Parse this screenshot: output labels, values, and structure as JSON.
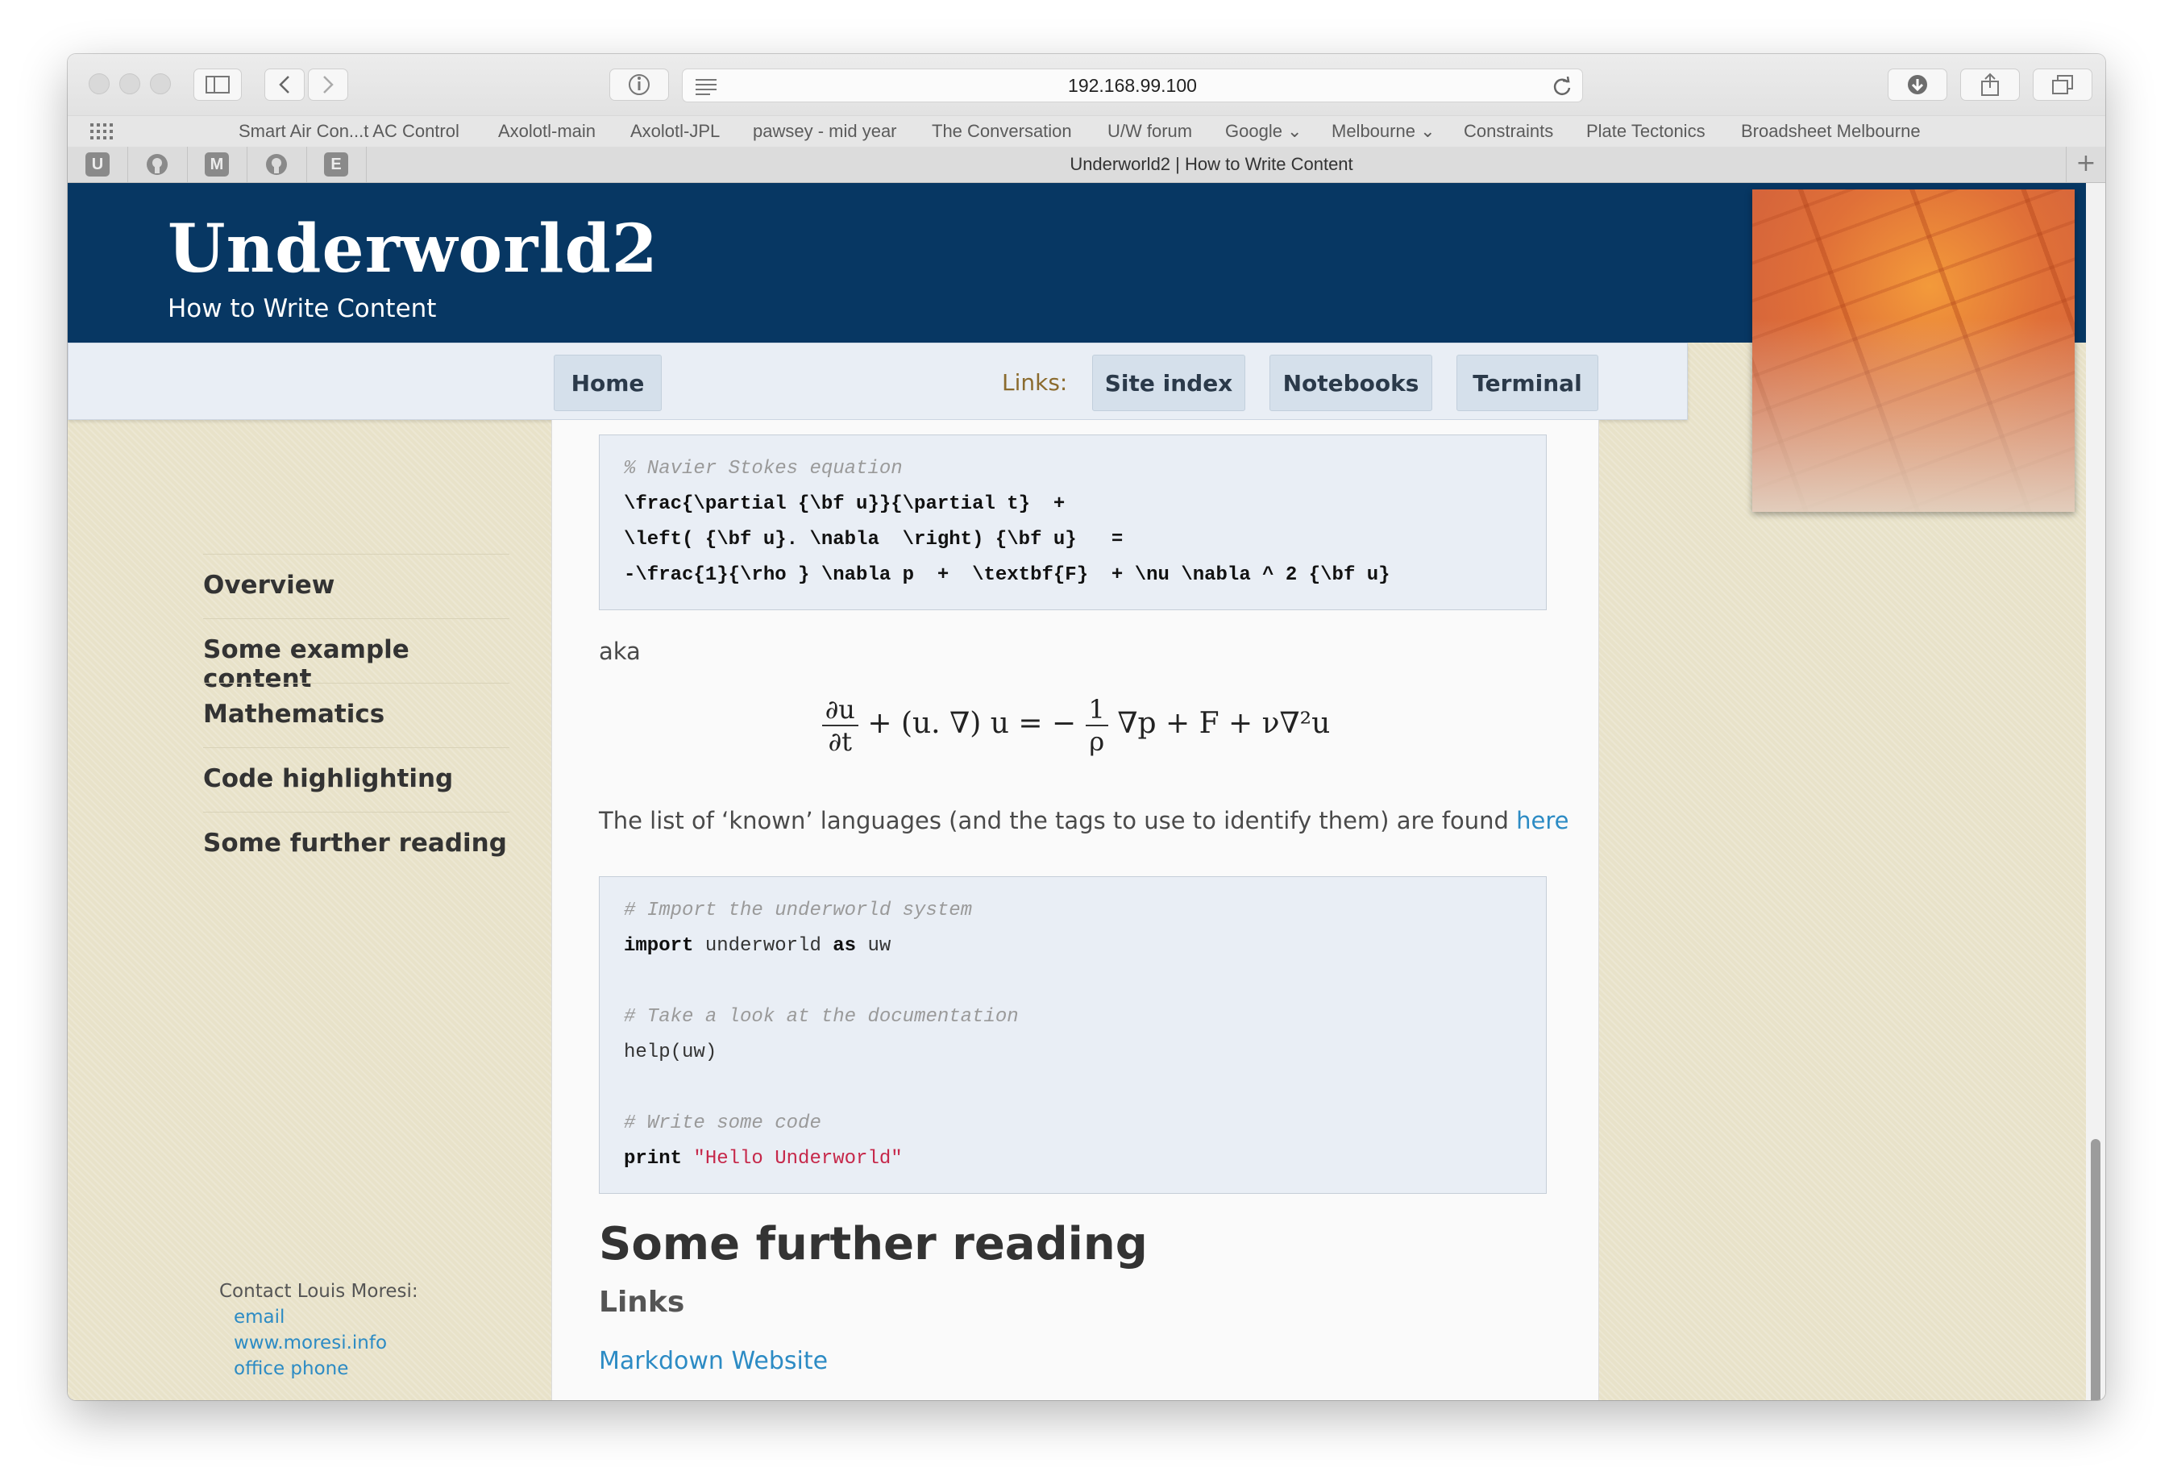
{
  "browser": {
    "url": "192.168.99.100",
    "tab_title": "Underworld2 | How to Write Content",
    "bookmarks": [
      "Smart Air Con...t AC Control",
      "Axolotl-main",
      "Axolotl-JPL",
      "pawsey - mid year",
      "The Conversation",
      "U/W forum",
      "Google ⌄",
      "Melbourne ⌄",
      "Constraints",
      "Plate Tectonics",
      "Broadsheet Melbourne"
    ],
    "pinned_tabs": [
      "U",
      "github",
      "M",
      "github",
      "E"
    ]
  },
  "site": {
    "title": "Underworld2",
    "subtitle": "How to Write Content"
  },
  "nav": {
    "home": "Home",
    "links_label": "Links:",
    "site_index": "Site index",
    "notebooks": "Notebooks",
    "terminal": "Terminal"
  },
  "sidebar": {
    "items": [
      "Overview",
      "Some example content",
      "Mathematics",
      "Code highlighting",
      "Some further reading"
    ],
    "contact_label": "Contact Louis Moresi:",
    "contact_links": [
      "email",
      "www.moresi.info",
      "office phone"
    ]
  },
  "content": {
    "latex_lines": [
      "% Navier Stokes equation",
      "\\frac{\\partial {\\bf u}}{\\partial t}  +",
      "\\left( {\\bf u}. \\nabla  \\right) {\\bf u}   =",
      "-\\frac{1}{\\rho } \\nabla p  +  \\textbf{F}  + \\nu \\nabla ^ 2 {\\bf u}"
    ],
    "aka": "aka",
    "equation": {
      "lhs_num": "∂u",
      "lhs_den": "∂t",
      "middle": "+ (u. ∇) u = −",
      "rho_num": "1",
      "rho_den": "ρ",
      "rhs": "∇p + F + ν∇²u"
    },
    "languages_text": "The list of ‘known’ languages (and the tags to use to identify them) are found ",
    "languages_link": "here",
    "code": {
      "comment1": "# Import the underworld system",
      "import_kw": "import",
      "import_mod": " underworld ",
      "as_kw": "as",
      "alias": " uw",
      "comment2": "# Take a look at the documentation",
      "help_line": "help(uw)",
      "comment3": "# Write some code",
      "print_kw": "print",
      "print_str": " \"Hello Underworld\""
    },
    "further_heading": "Some further reading",
    "links_heading": "Links",
    "markdown_link": "Markdown Website"
  }
}
